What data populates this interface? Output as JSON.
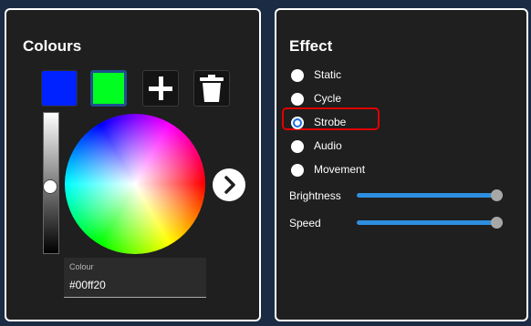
{
  "colours_panel": {
    "title": "Colours",
    "swatches": [
      {
        "color": "#0022ff",
        "selected": false
      },
      {
        "color": "#00ff20",
        "selected": true
      }
    ],
    "add_button_icon": "plus-icon",
    "delete_button_icon": "trash-icon",
    "next_button_icon": "chevron-right-icon",
    "brightness_level": 0.5,
    "colour_field": {
      "label": "Colour",
      "value": "#00ff20"
    }
  },
  "effect_panel": {
    "title": "Effect",
    "options": [
      {
        "label": "Static",
        "checked": false
      },
      {
        "label": "Cycle",
        "checked": false
      },
      {
        "label": "Strobe",
        "checked": true
      },
      {
        "label": "Audio",
        "checked": false
      },
      {
        "label": "Movement",
        "checked": false
      }
    ],
    "sliders": [
      {
        "label": "Brightness",
        "value": 1.0
      },
      {
        "label": "Speed",
        "value": 1.0
      }
    ]
  },
  "colors": {
    "panel_bg": "#1f1f1f",
    "page_bg": "#1b2b44",
    "accent_blue": "#2e8fe0",
    "highlight_red": "#e00000"
  }
}
